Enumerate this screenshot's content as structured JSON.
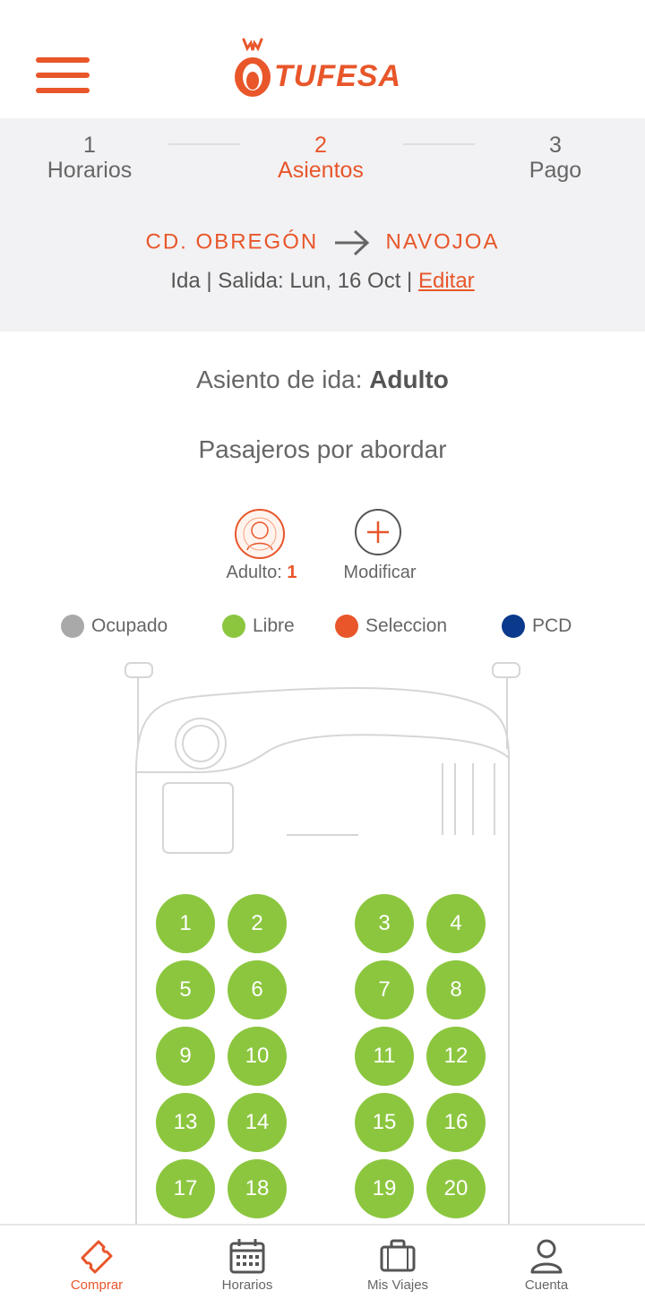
{
  "brand": {
    "name": "TUFESA",
    "accent": "#E8562A"
  },
  "header": {
    "menu_icon": "hamburger-menu-icon"
  },
  "steps": [
    {
      "number": "1",
      "label": "Horarios",
      "active": false
    },
    {
      "number": "2",
      "label": "Asientos",
      "active": true
    },
    {
      "number": "3",
      "label": "Pago",
      "active": false
    }
  ],
  "route": {
    "origin": "CD. OBREGÓN",
    "destination": "NAVOJOA",
    "arrow_icon": "arrow-right-icon"
  },
  "trip_info": {
    "text": "Ida | Salida: Lun, 16 Oct |",
    "edit_label": "Editar"
  },
  "seat_section": {
    "label": "Asiento de ida:",
    "type": "Adulto"
  },
  "passengers": {
    "title": "Pasajeros por abordar",
    "adult_label": "Adulto:",
    "adult_count": "1",
    "modify_label": "Modificar"
  },
  "legend": [
    {
      "label": "Ocupado",
      "color": "#A9A9A9"
    },
    {
      "label": "Libre",
      "color": "#8CC63F"
    },
    {
      "label": "Seleccion",
      "color": "#E8562A"
    },
    {
      "label": "PCD",
      "color": "#0B3A8C"
    }
  ],
  "seats": [
    "1",
    "2",
    "3",
    "4",
    "5",
    "6",
    "7",
    "8",
    "9",
    "10",
    "11",
    "12",
    "13",
    "14",
    "15",
    "16",
    "17",
    "18",
    "19",
    "20"
  ],
  "seat_color_free": "#8CC63F",
  "bottom_nav": [
    {
      "label": "Comprar",
      "icon": "ticket-icon",
      "active": true
    },
    {
      "label": "Horarios",
      "icon": "calendar-icon",
      "active": false
    },
    {
      "label": "Mis Viajes",
      "icon": "suitcase-icon",
      "active": false
    },
    {
      "label": "Cuenta",
      "icon": "user-icon",
      "active": false
    }
  ]
}
